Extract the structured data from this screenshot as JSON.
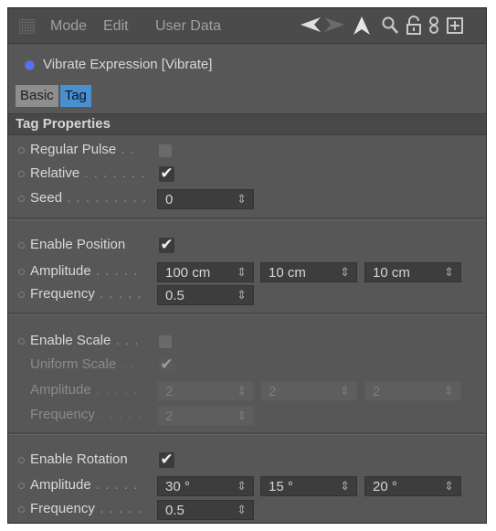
{
  "menubar": {
    "items": [
      "Mode",
      "Edit",
      "User Data"
    ],
    "icons": [
      "back-arrow-icon",
      "forward-arrow-icon",
      "up-arrow-icon",
      "search-icon",
      "lock-icon",
      "link-icon",
      "new-manager-icon"
    ]
  },
  "object": {
    "label": "Vibrate Expression [Vibrate]",
    "dot_color": "#5a6cff"
  },
  "tabs": [
    {
      "label": "Basic",
      "active": false
    },
    {
      "label": "Tag",
      "active": true
    }
  ],
  "section_title": "Tag Properties",
  "rows": {
    "regular_pulse": {
      "label": "Regular Pulse",
      "dots": " . .",
      "checked": false
    },
    "relative": {
      "label": "Relative",
      "dots": " . . . . . . .",
      "checked": true
    },
    "seed": {
      "label": "Seed",
      "dots": " . . . . . . . . .",
      "value": "0"
    },
    "enable_position": {
      "label": "Enable Position",
      "checked": true
    },
    "pos_amplitude": {
      "label": "Amplitude",
      "dots": " . . . . .",
      "values": [
        "100 cm",
        "10 cm",
        "10 cm"
      ]
    },
    "pos_frequency": {
      "label": "Frequency",
      "dots": " . . . . .",
      "value": "0.5"
    },
    "enable_scale": {
      "label": "Enable Scale",
      "dots": " . . .",
      "checked": false
    },
    "uniform_scale": {
      "label": "Uniform Scale",
      "dots": " . .",
      "checked": true
    },
    "scale_amplitude": {
      "label": "Amplitude",
      "dots": " . . . . .",
      "values": [
        "2",
        "2",
        "2"
      ]
    },
    "scale_frequency": {
      "label": "Frequency",
      "dots": " . . . . .",
      "value": "2"
    },
    "enable_rotation": {
      "label": "Enable Rotation",
      "checked": true
    },
    "rot_amplitude": {
      "label": "Amplitude",
      "dots": " . . . . .",
      "values": [
        "30 °",
        "15 °",
        "20 °"
      ]
    },
    "rot_frequency": {
      "label": "Frequency",
      "dots": " . . . . .",
      "value": "0.5"
    }
  },
  "glyphs": {
    "check": "✔",
    "spinner": "⇕"
  },
  "colors": {
    "accent_tab": "#4a8fd0",
    "panel_bg": "#575757"
  }
}
